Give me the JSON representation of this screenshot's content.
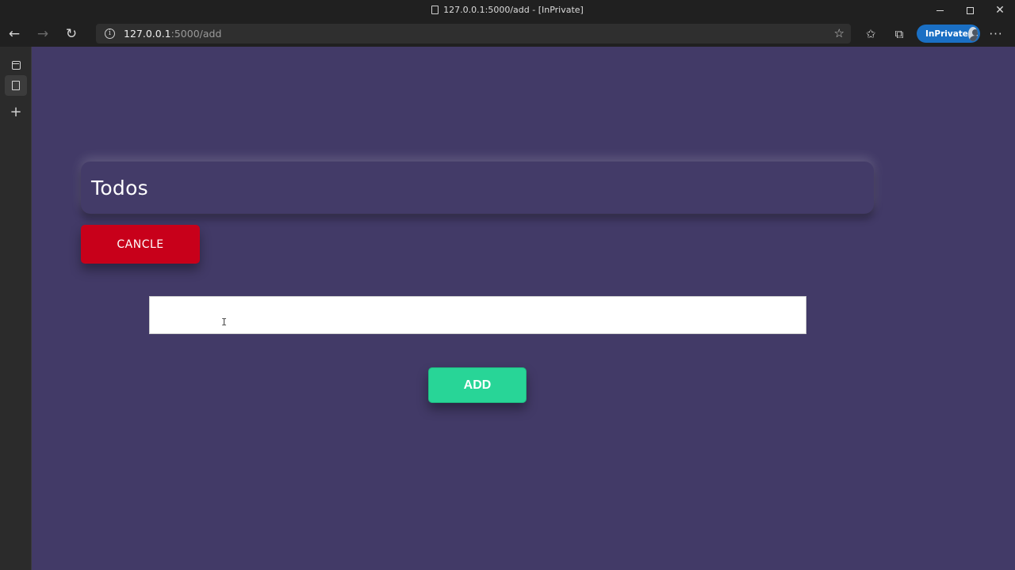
{
  "browser": {
    "window_title": "127.0.0.1:5000/add - [InPrivate]",
    "url_host": "127.0.0.1",
    "url_path": ":5000/add",
    "inprivate_label": "InPrivate",
    "controls": {
      "minimize": "—",
      "maximize": "",
      "close": "✕"
    },
    "nav": {
      "back_icon": "←",
      "forward_icon": "→",
      "refresh_icon": "↻"
    },
    "icons": [
      "info-icon",
      "favorite-add-icon",
      "favorites-icon",
      "collections-icon",
      "more-icon",
      "tabs-icon",
      "page-icon",
      "plus-icon"
    ]
  },
  "page": {
    "header_title": "Todos",
    "cancel_label": "CANCLE",
    "todo_input_value": "",
    "todo_input_placeholder": "",
    "add_label": "ADD",
    "colors": {
      "background": "#423a67",
      "cancel": "#c8001a",
      "add": "#28d597"
    }
  }
}
